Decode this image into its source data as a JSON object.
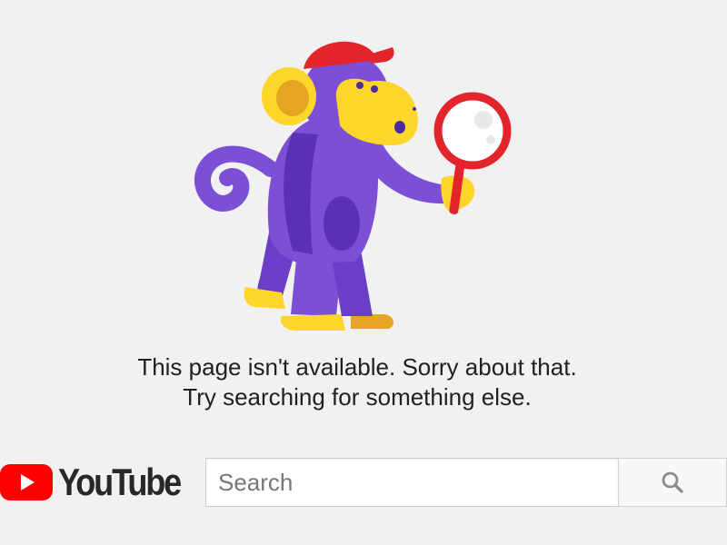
{
  "error": {
    "line1": "This page isn't available. Sorry about that.",
    "line2": "Try searching for something else."
  },
  "brand": {
    "name": "YouTube",
    "logo_red": "#ff0000",
    "text_color": "#282828"
  },
  "search": {
    "placeholder": "Search",
    "value": "",
    "button_icon": "search-icon"
  },
  "illustration": {
    "icon": "monkey-with-magnifying-glass-icon",
    "colors": {
      "body": "#7b4fd6",
      "face": "#fdd52b",
      "cap": "#e4242b",
      "magnifier": "#e4242b"
    }
  },
  "background_color": "#f1f1f1"
}
